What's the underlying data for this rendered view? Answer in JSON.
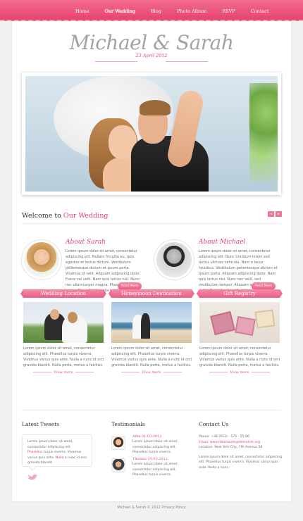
{
  "nav": {
    "items": [
      "Home",
      "Our Wedding",
      "Blog",
      "Photo Album",
      "RSVP",
      "Contact"
    ]
  },
  "header": {
    "title": "Michael & Sarah",
    "date": "23 April 2012"
  },
  "welcome": {
    "prefix": "Welcome to",
    "highlight": "Our Wedding"
  },
  "people": [
    {
      "name": "About Sarah",
      "text": "Lorem ipsum dolor sit amet, consectetur adipiscing elit. Nullam fringilla eu, quis egestas et lectus dictum. Vestibulum pellentesque dictum et ipsum porta. Vivamus id velit. Aliquam adipiscing dolor. Fusce vel velit. Nam quis lectus nisl. Nunc nec ullamcorper magna. Phasellus sed lorem. Phasellus fringilla turpis.",
      "button": "Read More"
    },
    {
      "name": "About Michael",
      "text": "Lorem ipsum dolor sit amet, consectetur adipiscing elit. Nunc tincidunt lorem sed lectus ultrices vehicula. Nam a lacus faucibus. Vestibulum pellentesque dictum et ipsum porta. Aliquam adipiscing dolor. Nam quis lectus nisl. Nunc nec velit, sed vestibulum tempor. Aliquam adipiscing dolor. Phasellus fringilla turpis.",
      "button": "Read More"
    }
  ],
  "columns": [
    {
      "title": "Wedding Location",
      "text": "Lorem ipsum dolor sit amet, consectetur adipiscing elit. Phasellus turpis viverra. Vivamus varius quis ante. Nulla a nunc id orci gravida blandit. Nulla porta, metus a facilisis.",
      "more": "View more"
    },
    {
      "title": "Honeymoon Destination",
      "text": "Lorem ipsum dolor sit amet, consectetur adipiscing elit. Phasellus turpis viverra. Vivamus varius quis ante. Nulla a nunc id orci gravida blandit. Nulla porta, metus a facilisis.",
      "more": "View more"
    },
    {
      "title": "Gift Registry",
      "text": "Lorem ipsum dolor sit amet, consectetur adipiscing elit. Phasellus turpis viverra. Vivamus varius quis ante. Nulla a nunc id orci gravida blandit. Nulla porta, metus a facilisis.",
      "more": "View more"
    }
  ],
  "tweets": {
    "title": "Latest Tweets",
    "line1": "Lorem ipsum dolor sit amet, consectetur adipiscing elit.",
    "link": "Phasellus",
    "line2": "turpis viverra. Vivamus varius quis ante.",
    "link2": "Nulla",
    "line3": "a nunc id orci gravida blandit."
  },
  "testimonials": {
    "title": "Testimonials",
    "items": [
      {
        "name": "Alba 21.03.2012",
        "text": "Lorem ipsum dolor sit amet, consectetur adipiscing elit. Phasellus turpis viverra."
      },
      {
        "name": "Thomas 20.03.2012",
        "text": "Lorem ipsum dolor sit amet, consectetur adipiscing elit. Phasellus turpis viverra."
      }
    ]
  },
  "contact": {
    "title": "Contact Us",
    "phone": "Phone: +38 (953) - 574 - 55 66",
    "email": "Email: www.littlemaids@demolink.org",
    "location": "Location: New York City, 7th Avenue 58",
    "text": "Lorem ipsum dolor sit amet, consectetur adipiscing elit. Phasellus turpis viverra. Vivamus varius quis ante. Nulla a nunc."
  },
  "footer": {
    "text": "Michael & Sarah © 2012 Privacy Policy"
  },
  "colors": {
    "accent": "#e4456f",
    "topbar": "#ee5a80"
  }
}
